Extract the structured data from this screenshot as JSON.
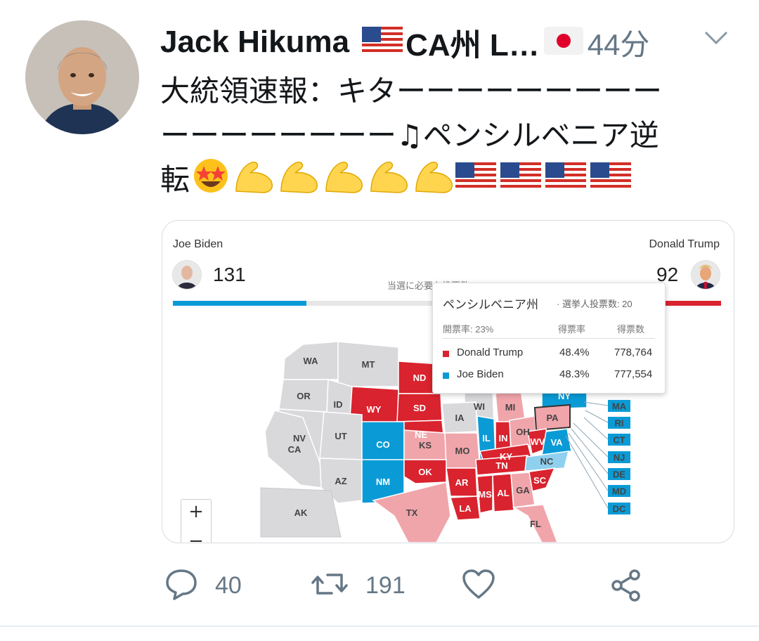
{
  "tweet": {
    "author_name": "Jack Hikuma",
    "author_suffix": "CA州 L…",
    "time": "44分",
    "text_line1": "大統領速報：キターーーーーーーーー",
    "text_line2": "ーーーーーーーー♫ペンシルベニア逆",
    "text_line3": "転"
  },
  "card": {
    "left_candidate": {
      "name": "Joe Biden",
      "votes": "131",
      "color": "#0a9bd6"
    },
    "right_candidate": {
      "name": "Donald Trump",
      "votes": "92",
      "color": "#d9232e"
    },
    "needed_label": "当選に必要な投票数: 270",
    "tooltip": {
      "title": "ペンシルベニア州",
      "subtitle": "· 選挙人投票数: 20",
      "reporting": "開票率: 23%",
      "col_pct": "得票率",
      "col_votes": "得票数",
      "rows": [
        {
          "name": "Donald Trump",
          "pct": "48.4%",
          "votes": "778,764",
          "color": "#d9232e"
        },
        {
          "name": "Joe Biden",
          "pct": "48.3%",
          "votes": "777,554",
          "color": "#0a9bd6"
        }
      ]
    },
    "zoom_in": "+",
    "zoom_out": "−",
    "states": [
      "WA",
      "MT",
      "ND",
      "OR",
      "ID",
      "WY",
      "SD",
      "WI",
      "MI",
      "NY",
      "NV",
      "UT",
      "NE",
      "IA",
      "IL",
      "IN",
      "OH",
      "PA",
      "CA",
      "CO",
      "KS",
      "MO",
      "KY",
      "WV",
      "VA",
      "AZ",
      "NM",
      "OK",
      "AR",
      "TN",
      "NC",
      "SC",
      "MS",
      "AL",
      "GA",
      "TX",
      "LA",
      "FL",
      "AK",
      "MA",
      "RI",
      "CT",
      "NJ",
      "DE",
      "MD",
      "DC"
    ],
    "colors": {
      "trump": "#d9232e",
      "trump_lean": "#f0a5ab",
      "biden": "#0a9bd6",
      "biden_lean": "#8fd0ef",
      "undecided": "#d9d9dc"
    }
  },
  "actions": {
    "replies": "40",
    "retweets": "191"
  }
}
